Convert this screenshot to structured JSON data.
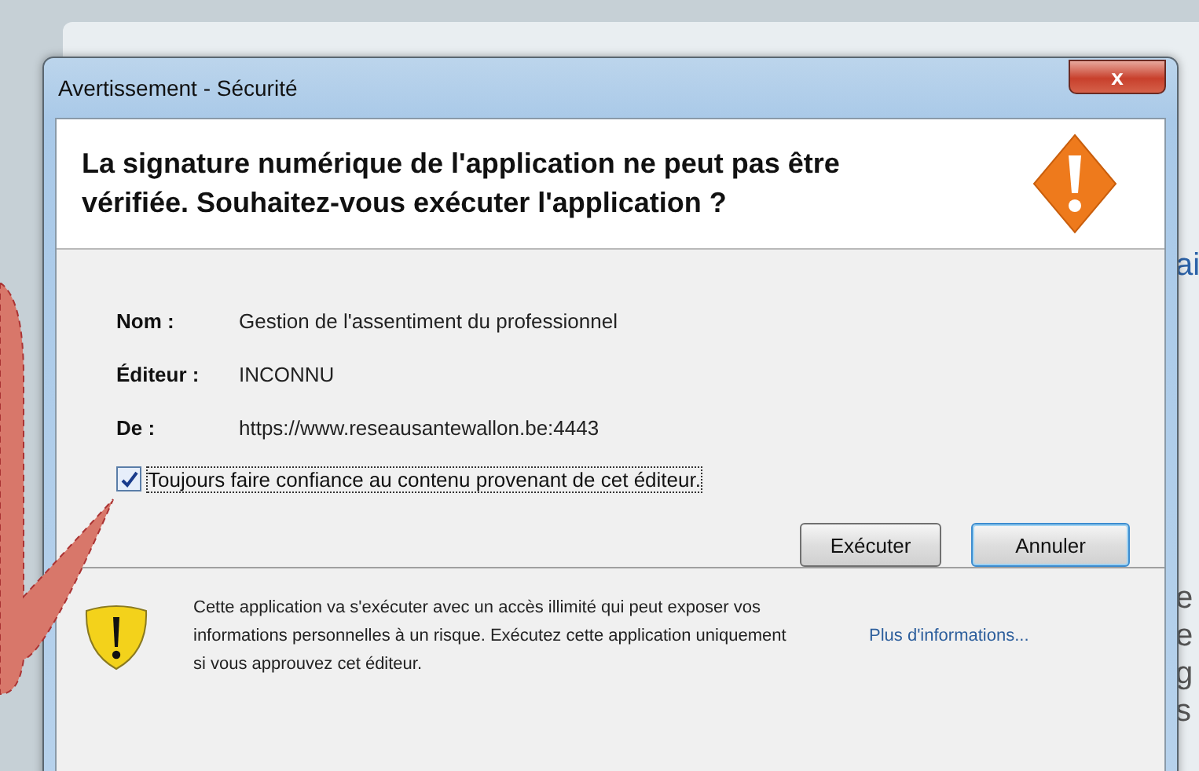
{
  "window": {
    "title": "Avertissement - Sécurité",
    "close": "x"
  },
  "header": {
    "message": "La signature numérique de l'application ne peut pas être vérifiée.  Souhaitez-vous exécuter l'application ?"
  },
  "fields": [
    {
      "label": "Nom :",
      "value": "Gestion de l'assentiment du professionnel"
    },
    {
      "label": "Éditeur :",
      "value": "INCONNU"
    },
    {
      "label": "De :",
      "value": "https://www.reseausantewallon.be:4443"
    }
  ],
  "trust_checkbox": {
    "label": "Toujours faire confiance au contenu provenant de cet éditeur.",
    "checked": true
  },
  "buttons": [
    {
      "label": "Exécuter",
      "default": false
    },
    {
      "label": "Annuler",
      "default": true
    }
  ],
  "footer": {
    "text": "Cette application va s'exécuter avec un accès illimité qui peut exposer vos informations personnelles à un risque. Exécutez cette application uniquement si vous approuvez cet éditeur.",
    "link": "Plus d'informations..."
  },
  "background_fragments": [
    {
      "text": "ai",
      "kind": "link"
    },
    {
      "text": "e",
      "kind": "text"
    },
    {
      "text": "e",
      "kind": "text"
    },
    {
      "text": "g",
      "kind": "text"
    },
    {
      "text": "s",
      "kind": "text"
    }
  ]
}
